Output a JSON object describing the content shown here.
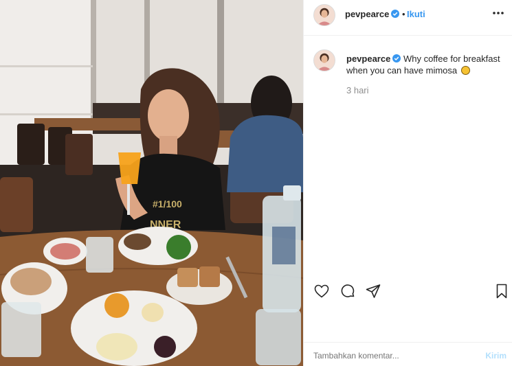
{
  "post": {
    "username": "pevpearce",
    "separator": "•",
    "follow_label": "Ikuti",
    "more_icon": "more-horizontal-icon",
    "verified_icon": "verified-badge-icon"
  },
  "caption": {
    "username": "pevpearce",
    "text": "Why coffee for breakfast when you can have mimosa",
    "emoji_icon": "laughing-emoji-icon",
    "time": "3 hari"
  },
  "actions": {
    "like_icon": "heart-icon",
    "comment_icon": "comment-icon",
    "share_icon": "send-icon",
    "save_icon": "bookmark-icon"
  },
  "comment_box": {
    "placeholder": "Tambahkan komentar...",
    "send_label": "Kirim"
  },
  "colors": {
    "link_blue": "#3897f0",
    "send_disabled": "#b2dffc",
    "muted_text": "#8e8e8e",
    "verified_blue": "#3897f0"
  }
}
